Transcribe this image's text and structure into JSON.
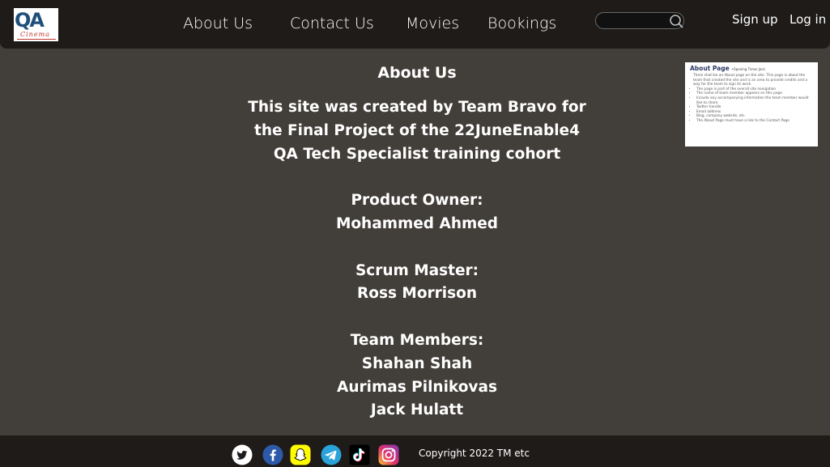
{
  "logo": {
    "text": "QA",
    "subtext": "Cinema"
  },
  "nav": {
    "items": [
      {
        "label": "About Us"
      },
      {
        "label": "Contact Us"
      },
      {
        "label": "Movies"
      },
      {
        "label": "Bookings"
      }
    ]
  },
  "search": {
    "placeholder": ""
  },
  "auth": {
    "signup_label": "Sign up",
    "login_label": "Log in"
  },
  "main": {
    "title": "About Us",
    "intro_lines": [
      "This site was created by Team Bravo for",
      "the Final Project of the 22JuneEnable4",
      "QA Tech Specialist training cohort"
    ],
    "product_owner_heading": "Product Owner:",
    "product_owner": "Mohammed Ahmed",
    "scrum_master_heading": "Scrum Master:",
    "scrum_master": "Ross Morrison",
    "team_heading": "Team Members:",
    "team_members": [
      "Shahan Shah",
      "Aurimas Pilnikovas",
      "Jack Hulatt"
    ]
  },
  "thumbnail": {
    "title": "About Page",
    "title_note": "•Opening Times  Jack",
    "paragraph": "There shall be an About page on the site. This page is about the team that created the site and is an area to provide credits and a way for the team to sign its work.",
    "bullets": [
      "The page is part of the overall site navigation",
      "The name of team member appears on this page",
      "Include any accompanying information the team member would like to share.",
      "Twitter handle",
      "Email address",
      "Blog, company website, etc.",
      "The About Page must have a link to the Contact Page"
    ]
  },
  "footer": {
    "social_icons": [
      "twitter-icon",
      "facebook-icon",
      "snapchat-icon",
      "telegram-icon",
      "tiktok-icon",
      "instagram-icon"
    ],
    "copyright": "Copyright 2022 TM etc"
  },
  "colors": {
    "header_bg": "#1e1b19",
    "page_bg": "#423e39",
    "text": "#ffffff"
  }
}
